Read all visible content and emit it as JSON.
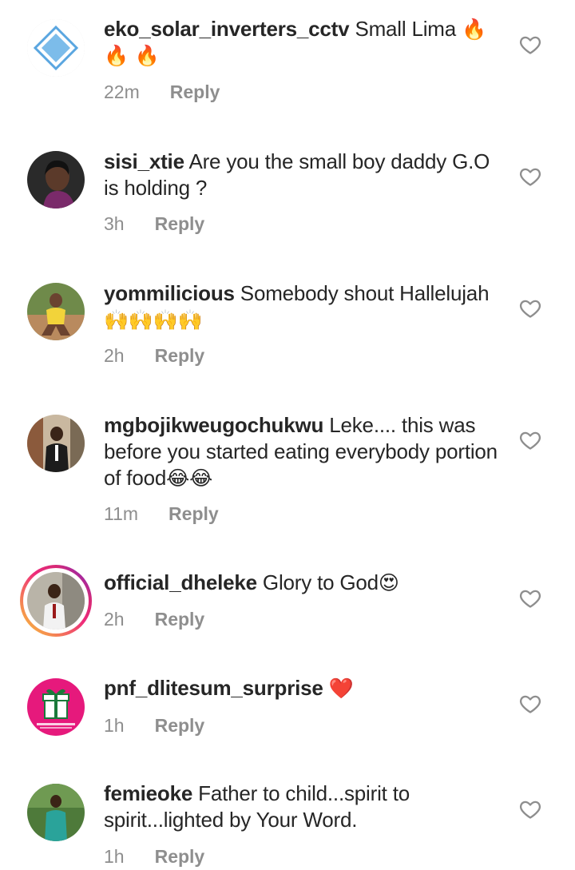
{
  "comments": [
    {
      "username": "eko_solar_inverters_cctv",
      "text": "Small Lima",
      "emoji": "🔥 🔥 🔥",
      "time": "22m",
      "reply_label": "Reply"
    },
    {
      "username": "sisi_xtie",
      "text": "Are you the small boy daddy G.O is holding ?",
      "emoji": "",
      "time": "3h",
      "reply_label": "Reply"
    },
    {
      "username": "yommilicious",
      "text": "Somebody shout Hallelujah",
      "emoji": "🙌🙌🙌🙌",
      "time": "2h",
      "reply_label": "Reply"
    },
    {
      "username": "mgbojikweugochukwu",
      "text": "Leke.... this was before you started eating everybody portion of food",
      "emoji": "😂😂",
      "time": "11m",
      "reply_label": "Reply"
    },
    {
      "username": "official_dheleke",
      "text": "Glory to God",
      "emoji": "😍",
      "time": "2h",
      "reply_label": "Reply"
    },
    {
      "username": "pnf_dlitesum_surprise",
      "text": "",
      "emoji": "❤️",
      "time": "1h",
      "reply_label": "Reply"
    },
    {
      "username": "femieoke",
      "text": "Father to child...spirit to spirit...lighted by Your Word.",
      "emoji": "",
      "time": "1h",
      "reply_label": "Reply"
    }
  ],
  "icons": {
    "like": "heart-outline-icon"
  },
  "colors": {
    "text": "#262626",
    "secondary": "#8e8e8e",
    "story_ring_start": "#f9ce34",
    "story_ring_end": "#6228d7",
    "avatar_pink": "#e6197c",
    "logo_blue": "#5aa6e0"
  }
}
